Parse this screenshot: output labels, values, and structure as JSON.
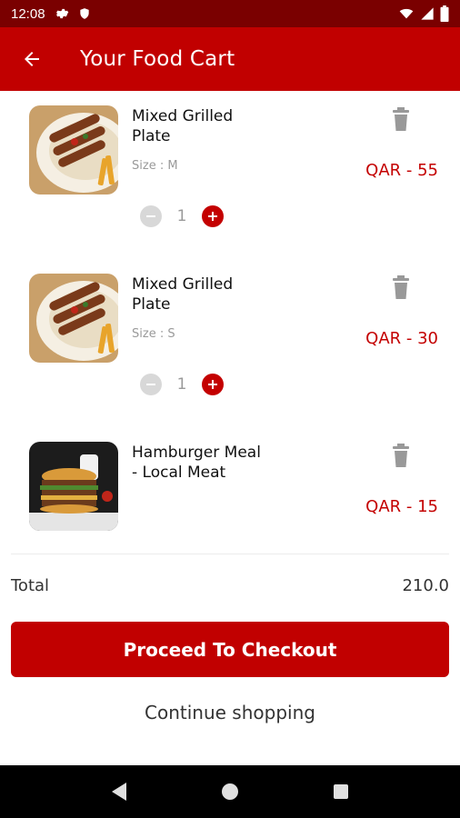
{
  "status_bar": {
    "time": "12:08",
    "icons": [
      "gear-icon",
      "shield-icon",
      "wifi-icon",
      "signal-icon",
      "battery-icon"
    ]
  },
  "app_bar": {
    "title": "Your Food Cart",
    "back_icon": "arrow-left-icon"
  },
  "cart": {
    "items": [
      {
        "name": "Mixed Grilled Plate",
        "size": "Size : M",
        "price": "QAR - 55",
        "quantity": "1",
        "image": "mixed-grill-image"
      },
      {
        "name": "Mixed Grilled Plate",
        "size": "Size : S",
        "price": "QAR - 30",
        "quantity": "1",
        "image": "mixed-grill-image"
      },
      {
        "name": "Hamburger Meal - Local Meat",
        "price": "QAR - 15",
        "image": "hamburger-image"
      }
    ]
  },
  "summary": {
    "total_label": "Total",
    "total_value": "210.0"
  },
  "actions": {
    "checkout_label": "Proceed To Checkout",
    "continue_label": "Continue shopping"
  },
  "colors": {
    "primary": "#c10000",
    "status_bar": "#7a0000",
    "price": "#c40000"
  }
}
